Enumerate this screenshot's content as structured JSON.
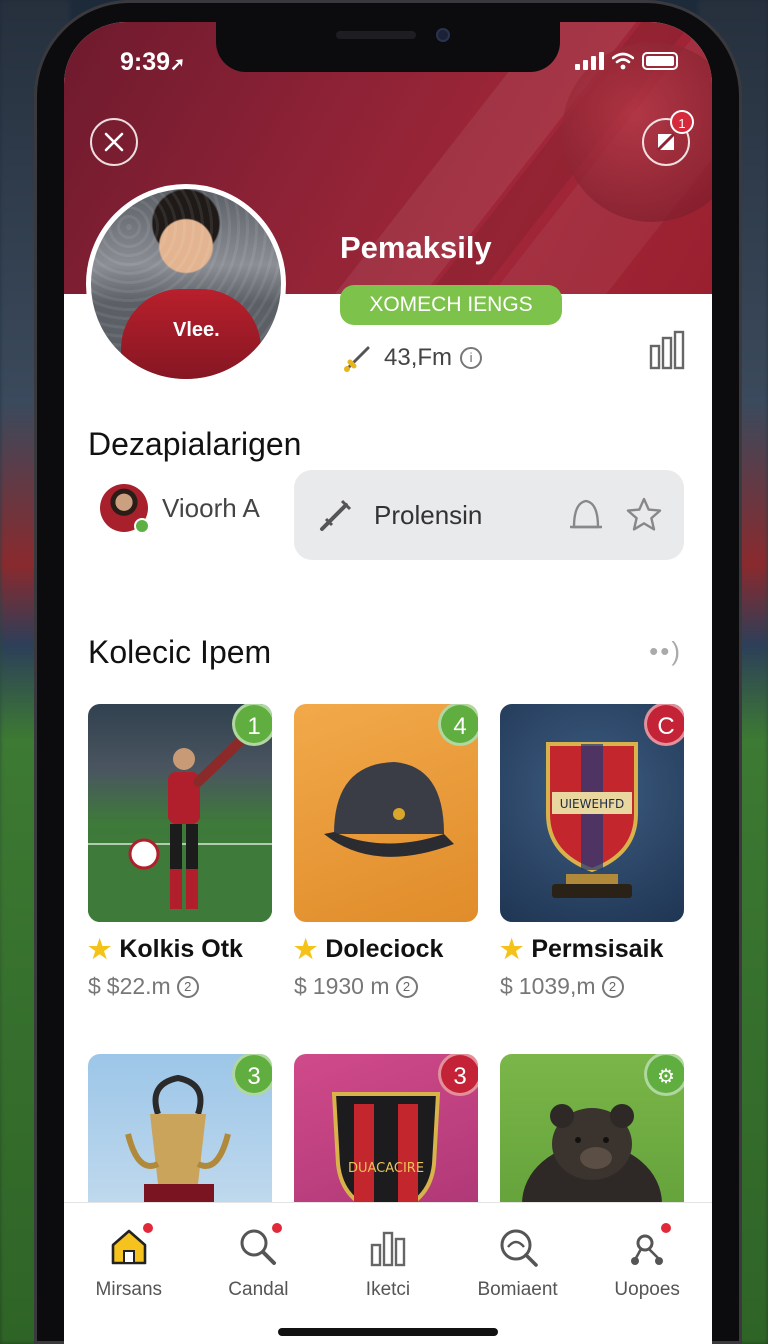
{
  "status": {
    "time": "9:39"
  },
  "profile": {
    "name": "Pemaksily",
    "level": "XOMECH IENGS",
    "coins": "43,Fm",
    "info": "i",
    "edit_badge": "1",
    "jersey": "Vlee."
  },
  "friends_section": {
    "title": "Dezapialarigen",
    "friend_name": "Vioorh A",
    "action_label": "Prolensin"
  },
  "collection": {
    "title": "Kolecic Ipem",
    "items": [
      {
        "name": "Kolkis Otk",
        "price": "$22.m",
        "badge": "1",
        "badge_color": "#5fae3f"
      },
      {
        "name": "Doleciock",
        "price": "1930 m",
        "badge": "4",
        "badge_color": "#5fae3f"
      },
      {
        "name": "Permsisaik",
        "price": "1039,m",
        "badge": "C",
        "badge_color": "#c42236"
      },
      {
        "name": "",
        "price": "",
        "badge": "3",
        "badge_color": "#5fae3f"
      },
      {
        "name": "",
        "price": "",
        "badge": "3",
        "badge_color": "#c42236"
      },
      {
        "name": "",
        "price": "",
        "badge": "",
        "badge_color": "#5fae3f"
      }
    ],
    "crest_text": "UIEWEHFD",
    "crest_text_2": "DUACACIRE"
  },
  "nav": [
    {
      "label": "Mirsans"
    },
    {
      "label": "Candal"
    },
    {
      "label": "Iketci"
    },
    {
      "label": "Bomiaent"
    },
    {
      "label": "Uopoes"
    }
  ],
  "colors": {
    "accent": "#7dc24b",
    "hero": "#8e2236",
    "alert": "#e02a3a"
  }
}
